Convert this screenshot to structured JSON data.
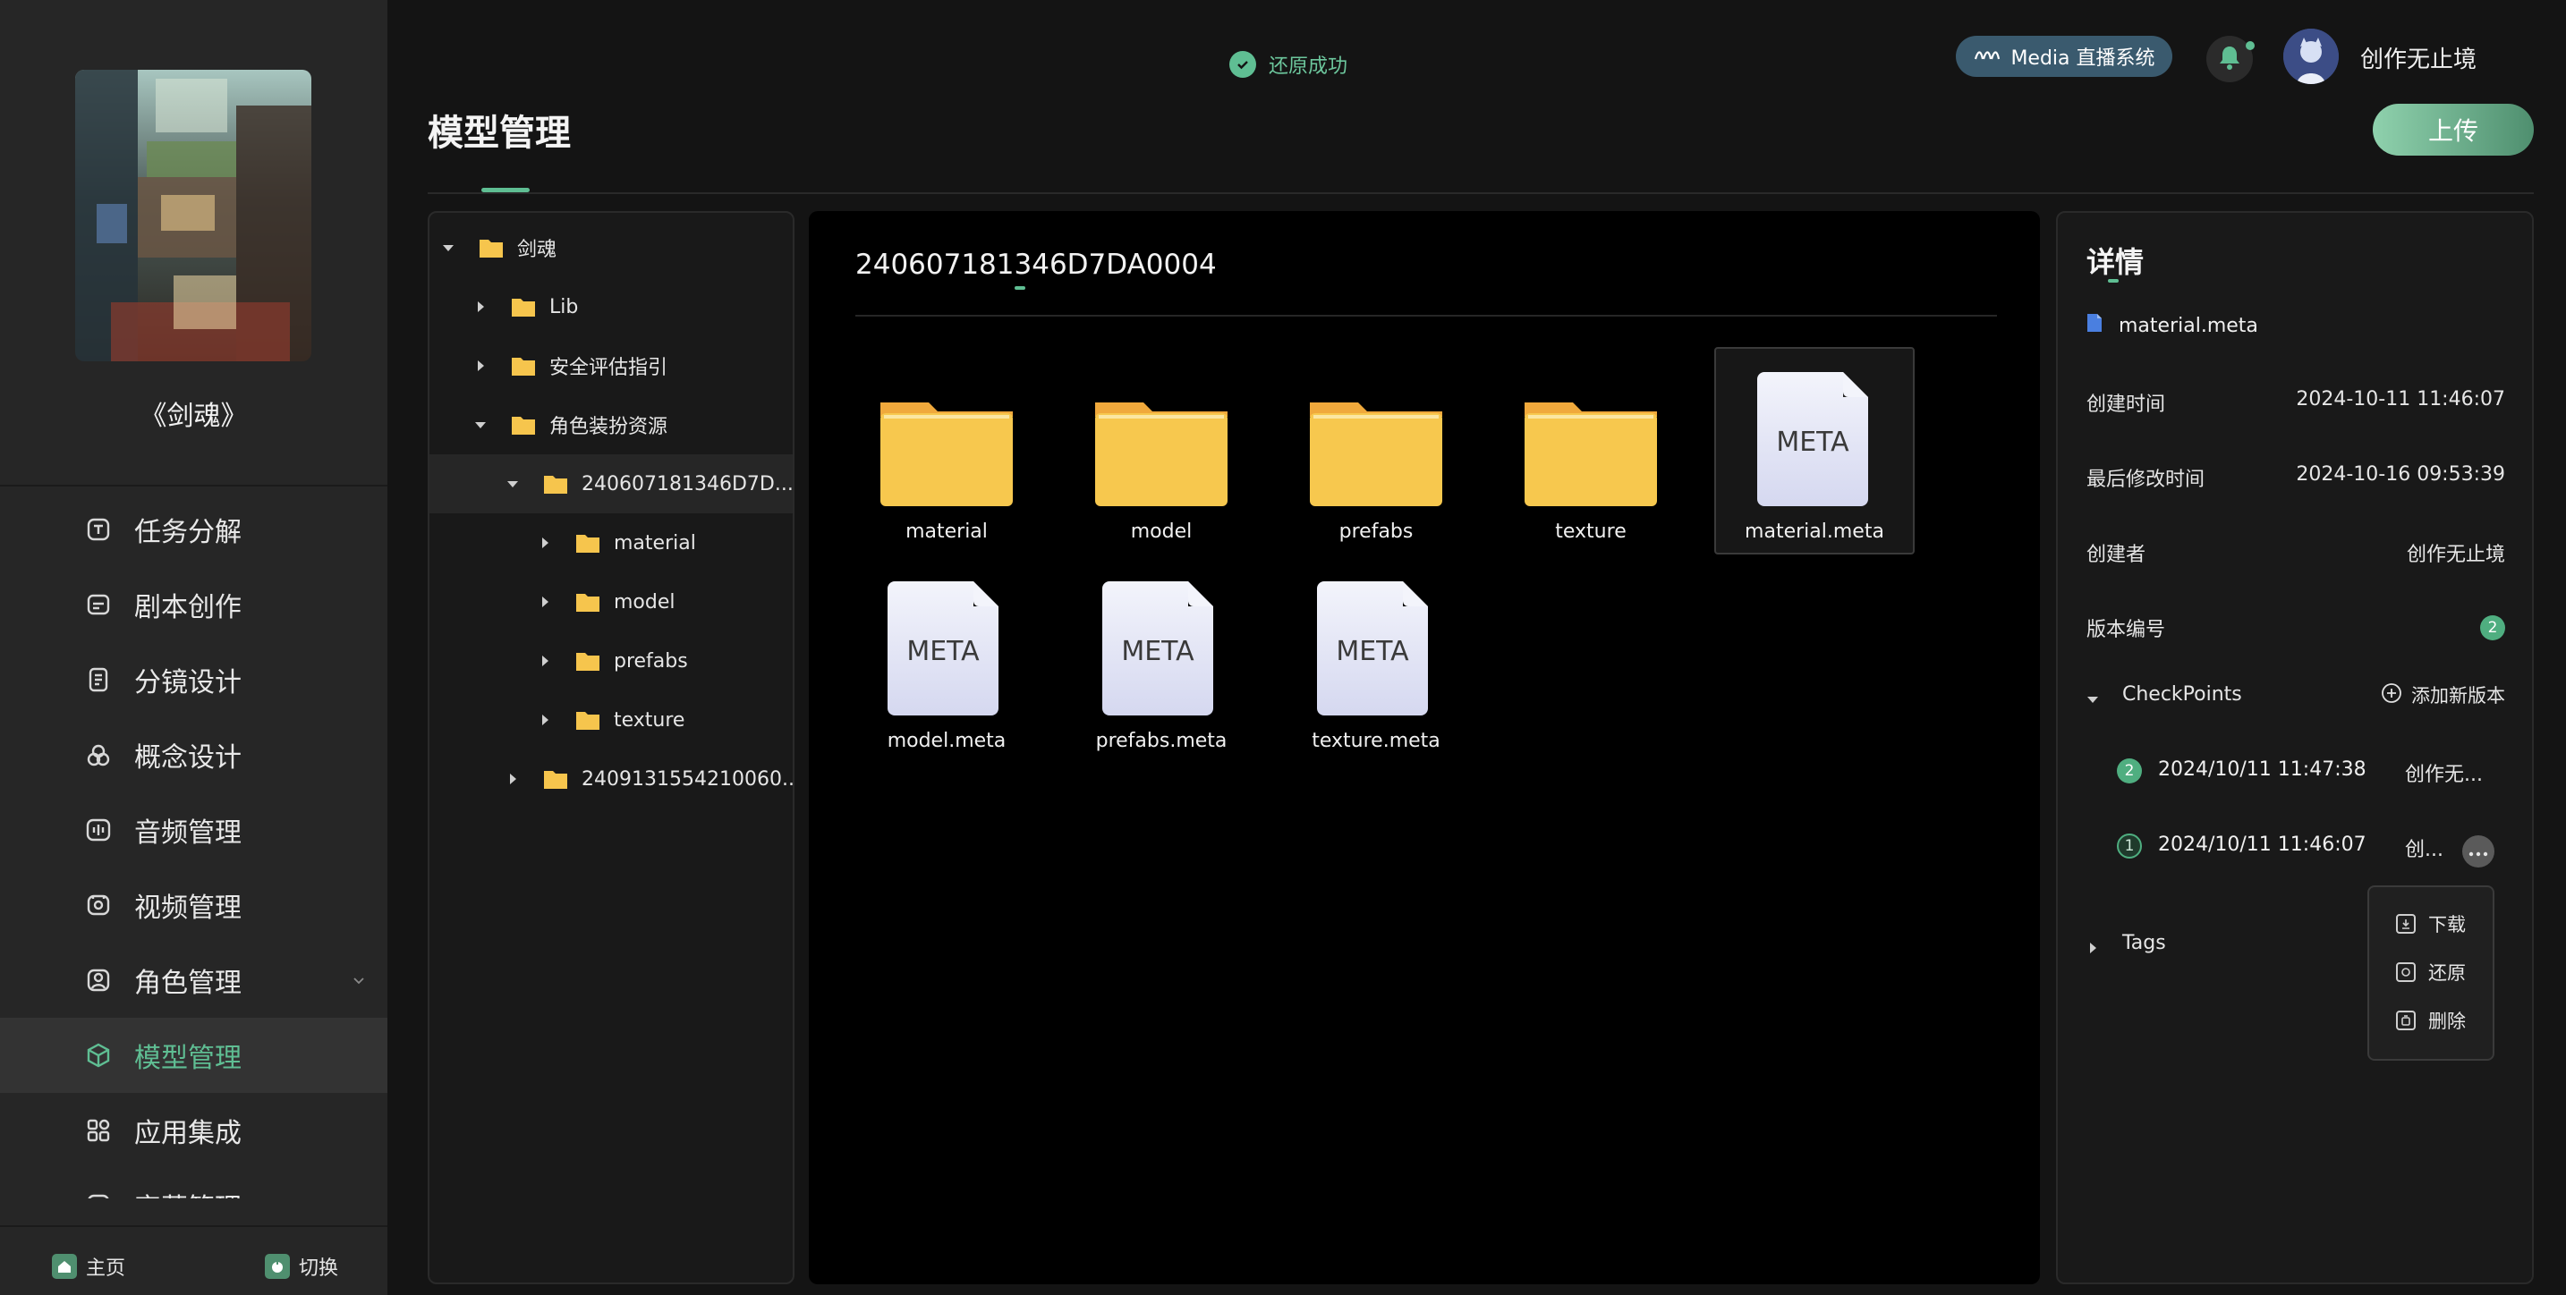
{
  "project": {
    "title": "《剑魂》"
  },
  "nav": {
    "items": [
      {
        "label": "任务分解",
        "icon": "task-icon"
      },
      {
        "label": "剧本创作",
        "icon": "script-icon"
      },
      {
        "label": "分镜设计",
        "icon": "storyboard-icon"
      },
      {
        "label": "概念设计",
        "icon": "concept-icon"
      },
      {
        "label": "音频管理",
        "icon": "audio-icon"
      },
      {
        "label": "视频管理",
        "icon": "video-icon"
      },
      {
        "label": "角色管理",
        "icon": "role-icon"
      },
      {
        "label": "模型管理",
        "icon": "model-icon",
        "active": true
      },
      {
        "label": "应用集成",
        "icon": "apps-icon"
      },
      {
        "label": "字幕管理",
        "icon": "subtitle-icon"
      }
    ]
  },
  "bottom": {
    "home_label": "主页",
    "switch_label": "切换"
  },
  "toast": {
    "text": "还原成功"
  },
  "header": {
    "media_label": "Media 直播系统",
    "user_name": "创作无止境",
    "page_title": "模型管理",
    "upload_label": "上传"
  },
  "tree": {
    "rows": [
      {
        "label": "剑魂",
        "level": 0,
        "expanded": true
      },
      {
        "label": "Lib",
        "level": 1,
        "expanded": false
      },
      {
        "label": "安全评估指引",
        "level": 1,
        "expanded": false
      },
      {
        "label": "角色装扮资源",
        "level": 1,
        "expanded": true
      },
      {
        "label": "240607181346D7D...",
        "level": 2,
        "expanded": true,
        "selected": true
      },
      {
        "label": "material",
        "level": 3,
        "expanded": false
      },
      {
        "label": "model",
        "level": 3,
        "expanded": false
      },
      {
        "label": "prefabs",
        "level": 3,
        "expanded": false
      },
      {
        "label": "texture",
        "level": 3,
        "expanded": false
      },
      {
        "label": "2409131554210060...",
        "level": 2,
        "expanded": false
      }
    ]
  },
  "main": {
    "folder_title": "240607181346D7DA0004",
    "items": [
      {
        "label": "material",
        "kind": "folder"
      },
      {
        "label": "model",
        "kind": "folder"
      },
      {
        "label": "prefabs",
        "kind": "folder"
      },
      {
        "label": "texture",
        "kind": "folder"
      },
      {
        "label": "material.meta",
        "kind": "meta",
        "badge": "META",
        "selected": true
      },
      {
        "label": "model.meta",
        "kind": "meta",
        "badge": "META"
      },
      {
        "label": "prefabs.meta",
        "kind": "meta",
        "badge": "META"
      },
      {
        "label": "texture.meta",
        "kind": "meta",
        "badge": "META"
      }
    ]
  },
  "detail": {
    "title": "详情",
    "file_name": "material.meta",
    "created_label": "创建时间",
    "created_value": "2024-10-11 11:46:07",
    "modified_label": "最后修改时间",
    "modified_value": "2024-10-16 09:53:39",
    "creator_label": "创建者",
    "creator_value": "创作无止境",
    "version_label": "版本编号",
    "version_value": "2",
    "checkpoints_label": "CheckPoints",
    "add_version_label": "添加新版本",
    "checkpoints": [
      {
        "num": "2",
        "time": "2024/10/11 11:47:38",
        "user": "创作无...",
        "current": true
      },
      {
        "num": "1",
        "time": "2024/10/11 11:46:07",
        "user": "创...",
        "current": false
      }
    ],
    "tags_label": "Tags"
  },
  "context_menu": {
    "download": "下载",
    "restore": "还原",
    "delete": "删除"
  },
  "colors": {
    "accent": "#5fbe93",
    "folder": "#f6c54d",
    "meta_doc": "#e4e6f6"
  }
}
